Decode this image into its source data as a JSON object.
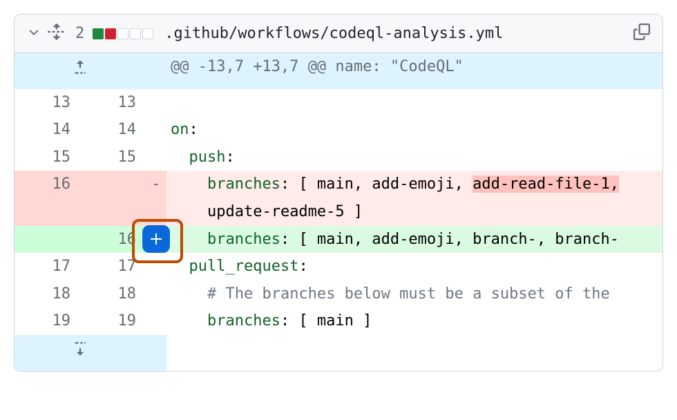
{
  "header": {
    "changes_count": "2",
    "file_path": ".github/workflows/codeql-analysis.yml"
  },
  "hunk": {
    "header": "@@ -13,7 +13,7 @@ name: \"CodeQL\""
  },
  "lines": {
    "l13": {
      "left": "13",
      "right": "13",
      "mark": "",
      "code": ""
    },
    "l14": {
      "left": "14",
      "right": "14",
      "mark": "",
      "key": "on",
      "after": ":"
    },
    "l15": {
      "left": "15",
      "right": "15",
      "mark": "",
      "key": "push",
      "after": ":"
    },
    "del16a": {
      "left": "16",
      "right": "",
      "mark": "-",
      "key": "branches",
      "pre": ": [ main, add-emoji, ",
      "highlight": "add-read-file-1,",
      "post": ""
    },
    "del16b": {
      "left": "",
      "right": "",
      "mark": "",
      "code": "update-readme-5 ]"
    },
    "add16": {
      "left": "",
      "right": "16",
      "mark": "+",
      "key": "branches",
      "after": ": [ main, add-emoji, branch-, branch-"
    },
    "l17": {
      "left": "17",
      "right": "17",
      "mark": "",
      "key": "pull_request",
      "after": ":"
    },
    "l18": {
      "left": "18",
      "right": "18",
      "mark": "",
      "comment": "# The branches below must be a subset of the "
    },
    "l19": {
      "left": "19",
      "right": "19",
      "mark": "",
      "key": "branches",
      "after": ": [ main ]"
    }
  }
}
